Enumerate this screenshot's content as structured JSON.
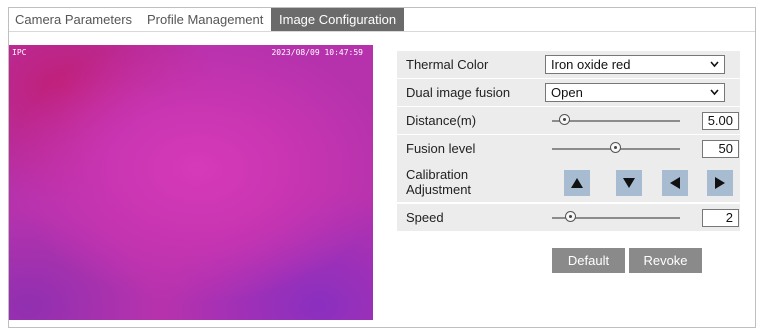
{
  "tabs": [
    {
      "label": "Camera Parameters"
    },
    {
      "label": "Profile Management"
    },
    {
      "label": "Image Configuration"
    }
  ],
  "video": {
    "osd_left": "IPC",
    "osd_timestamp": "2023/08/09 10:47:59"
  },
  "settings": {
    "thermal_color": {
      "label": "Thermal Color",
      "value": "Iron oxide red"
    },
    "dual_image_fusion": {
      "label": "Dual image fusion",
      "value": "Open"
    },
    "distance": {
      "label": "Distance(m)",
      "value": "5.00",
      "slider_fraction": 0.1
    },
    "fusion_level": {
      "label": "Fusion level",
      "value": "50",
      "slider_fraction": 0.5
    },
    "calibration": {
      "label_line1": "Calibration",
      "label_line2": "Adjustment"
    },
    "speed": {
      "label": "Speed",
      "value": "2",
      "slider_fraction": 0.15
    }
  },
  "buttons": {
    "default_label": "Default",
    "revoke_label": "Revoke"
  },
  "colors": {
    "active_tab": "#6b6b6b",
    "row_background": "#ececec",
    "arrow_button": "#a7bcd1",
    "action_button": "#8a8a8a"
  },
  "icons": [
    "chevron-down-icon",
    "arrow-up-icon",
    "arrow-down-icon",
    "arrow-left-icon",
    "arrow-right-icon"
  ]
}
